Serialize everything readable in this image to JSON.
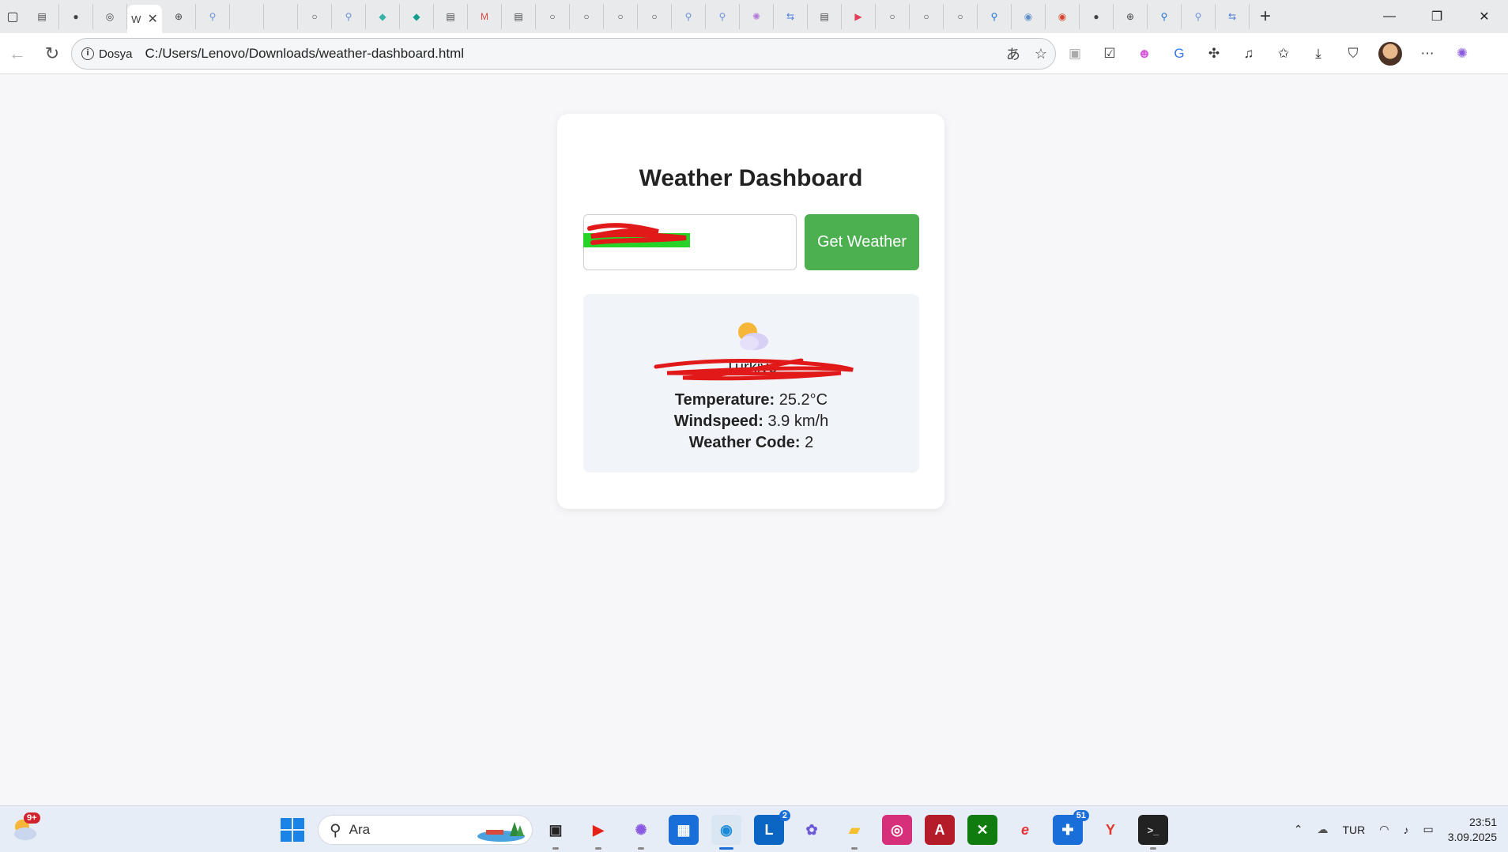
{
  "browser": {
    "tab_title": "W",
    "address": {
      "security_label": "Dosya",
      "url": "C:/Users/Lenovo/Downloads/weather-dashboard.html"
    }
  },
  "app": {
    "title": "Weather Dashboard",
    "city_input_value": "",
    "get_weather_label": "Get Weather",
    "result": {
      "weather_icon": "partly-cloudy-icon",
      "location": "Türkiye",
      "temperature_label": "Temperature:",
      "temperature_value": "25.2°C",
      "windspeed_label": "Windspeed:",
      "windspeed_value": "3.9 km/h",
      "weather_code_label": "Weather Code:",
      "weather_code_value": "2"
    }
  },
  "taskbar": {
    "weather_badge": "9+",
    "search_placeholder": "Ara",
    "linkedin_badge": "2",
    "app_badge": "51",
    "language": "TUR",
    "time": "23:51",
    "date": "3.09.2025"
  },
  "colors": {
    "accent_button": "#4caf50",
    "result_bg": "#f1f5fa",
    "page_bg": "#f7f7f9"
  }
}
